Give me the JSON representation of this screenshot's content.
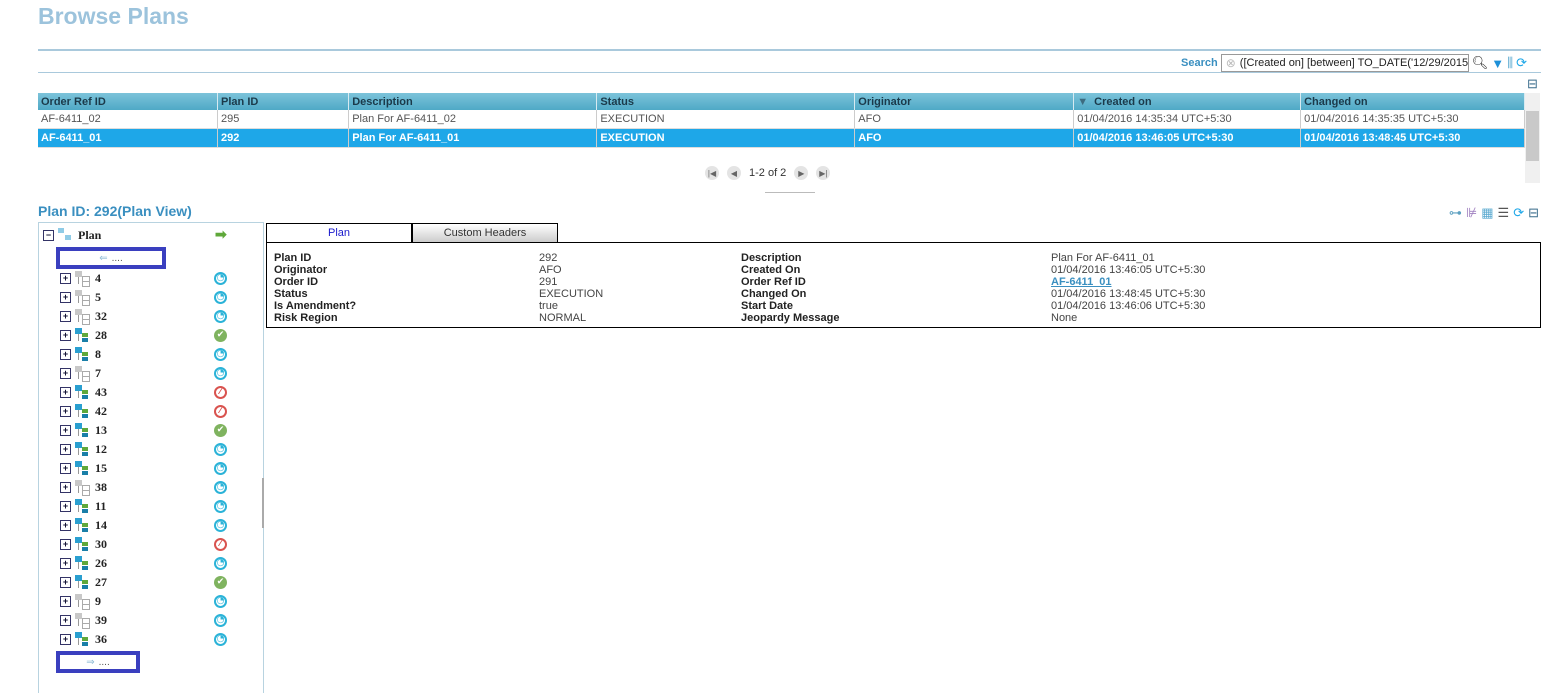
{
  "title": "Browse Plans",
  "search": {
    "label": "Search",
    "value": "([Created on] [between] TO_DATE('12/29/2015"
  },
  "grid": {
    "columns": [
      "Order Ref ID",
      "Plan ID",
      "Description",
      "Status",
      "Originator",
      "Created on",
      "Changed on"
    ],
    "rows": [
      [
        "AF-6411_02",
        "295",
        "Plan For AF-6411_02",
        "EXECUTION",
        "AFO",
        "01/04/2016 14:35:34 UTC+5:30",
        "01/04/2016 14:35:35 UTC+5:30"
      ],
      [
        "AF-6411_01",
        "292",
        "Plan For AF-6411_01",
        "EXECUTION",
        "AFO",
        "01/04/2016 13:46:05 UTC+5:30",
        "01/04/2016 13:48:45 UTC+5:30"
      ]
    ],
    "selected_row": 1,
    "sort_column": "Created on"
  },
  "pager": {
    "text": "1-2 of 2"
  },
  "plan_heading": "Plan ID: 292(Plan View)",
  "tree": {
    "root": "Plan",
    "prev": "....",
    "next": "....",
    "nodes": [
      {
        "id": "4",
        "active": false,
        "status": "pending"
      },
      {
        "id": "5",
        "active": false,
        "status": "pending"
      },
      {
        "id": "32",
        "active": false,
        "status": "pending"
      },
      {
        "id": "28",
        "active": true,
        "status": "done"
      },
      {
        "id": "8",
        "active": true,
        "status": "pending"
      },
      {
        "id": "7",
        "active": false,
        "status": "pending"
      },
      {
        "id": "43",
        "active": true,
        "status": "blocked"
      },
      {
        "id": "42",
        "active": true,
        "status": "blocked"
      },
      {
        "id": "13",
        "active": true,
        "status": "done"
      },
      {
        "id": "12",
        "active": true,
        "status": "pending"
      },
      {
        "id": "15",
        "active": true,
        "status": "pending"
      },
      {
        "id": "38",
        "active": false,
        "status": "pending"
      },
      {
        "id": "11",
        "active": true,
        "status": "pending"
      },
      {
        "id": "14",
        "active": true,
        "status": "pending"
      },
      {
        "id": "30",
        "active": true,
        "status": "blocked"
      },
      {
        "id": "26",
        "active": true,
        "status": "pending"
      },
      {
        "id": "27",
        "active": true,
        "status": "done"
      },
      {
        "id": "9",
        "active": false,
        "status": "pending"
      },
      {
        "id": "39",
        "active": false,
        "status": "pending"
      },
      {
        "id": "36",
        "active": true,
        "status": "pending"
      }
    ]
  },
  "tabs": [
    "Plan",
    "Custom Headers"
  ],
  "details": {
    "left": [
      {
        "label": "Plan ID",
        "value": "292"
      },
      {
        "label": "Originator",
        "value": "AFO"
      },
      {
        "label": "Order ID",
        "value": "291"
      },
      {
        "label": "Status",
        "value": "EXECUTION"
      },
      {
        "label": "Is Amendment?",
        "value": "true"
      },
      {
        "label": "Risk Region",
        "value": "NORMAL"
      }
    ],
    "right": [
      {
        "label": "Description",
        "value": "Plan For AF-6411_01"
      },
      {
        "label": "Created On",
        "value": "01/04/2016 13:46:05 UTC+5:30"
      },
      {
        "label": "Order Ref ID",
        "value": "AF-6411_01",
        "link": true
      },
      {
        "label": "Changed On",
        "value": "01/04/2016 13:48:45 UTC+5:30"
      },
      {
        "label": "Start Date",
        "value": "01/04/2016 13:46:06 UTC+5:30"
      },
      {
        "label": "Jeopardy Message",
        "value": "None"
      }
    ]
  }
}
